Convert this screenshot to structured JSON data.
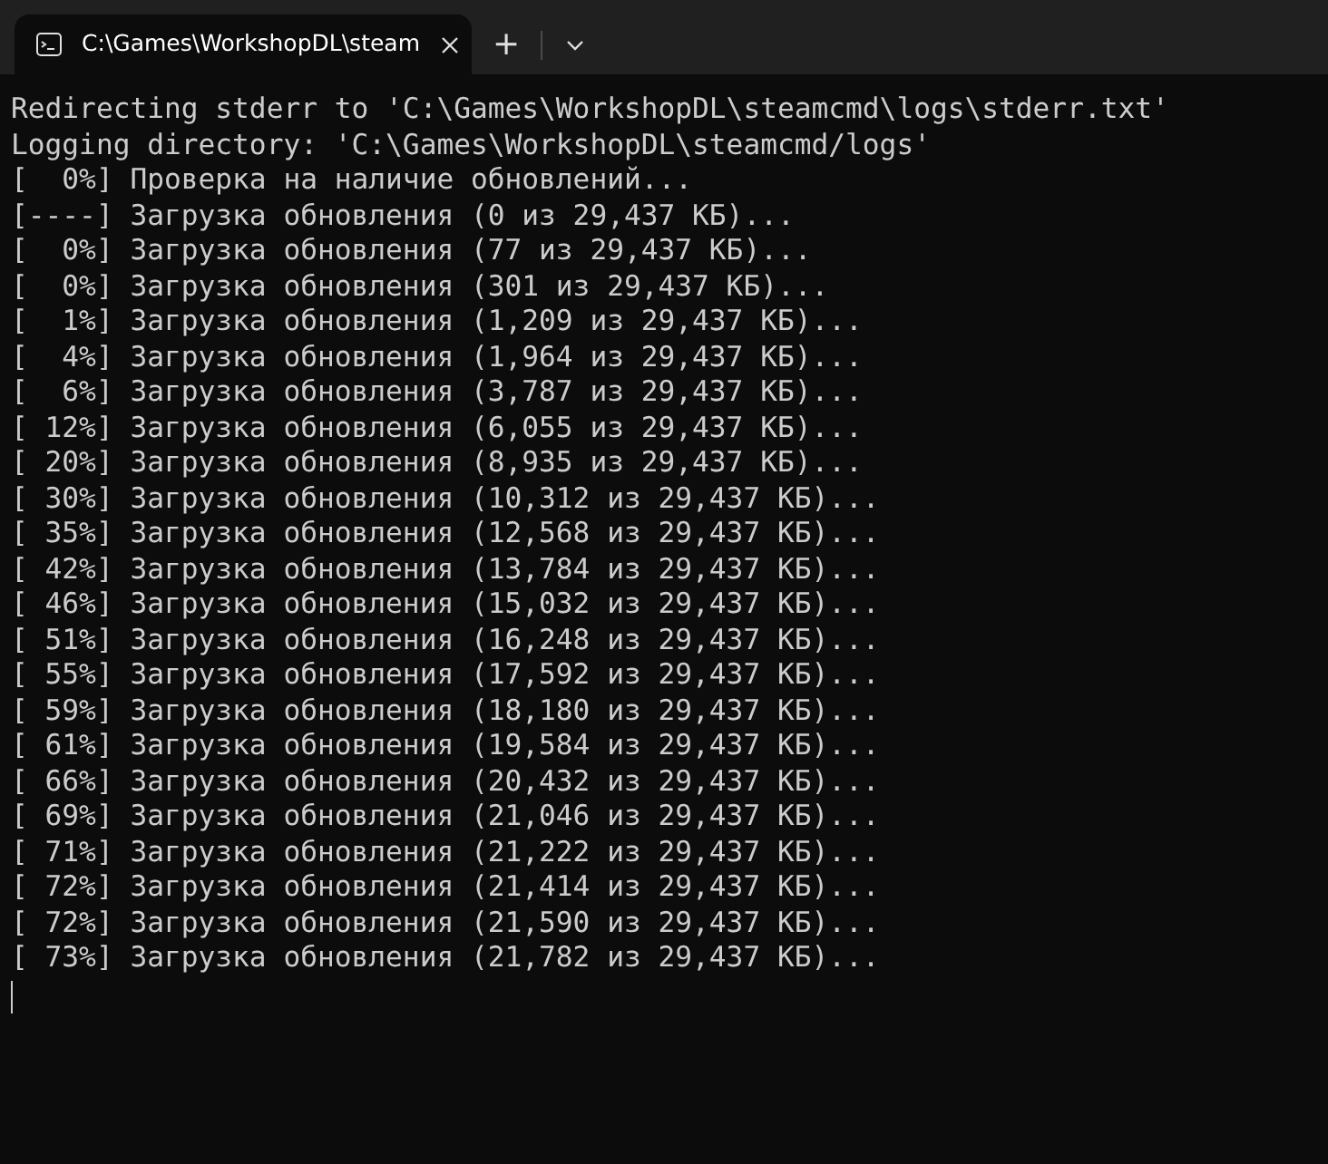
{
  "tab": {
    "title": "C:\\Games\\WorkshopDL\\steam",
    "selected": true
  },
  "new_tab_button": "+",
  "lines": [
    "Redirecting stderr to 'C:\\Games\\WorkshopDL\\steamcmd\\logs\\stderr.txt'",
    "Logging directory: 'C:\\Games\\WorkshopDL\\steamcmd/logs'",
    "[  0%] Проверка на наличие обновлений...",
    "[----] Загрузка обновления (0 из 29,437 КБ)...",
    "[  0%] Загрузка обновления (77 из 29,437 КБ)...",
    "[  0%] Загрузка обновления (301 из 29,437 КБ)...",
    "[  1%] Загрузка обновления (1,209 из 29,437 КБ)...",
    "[  4%] Загрузка обновления (1,964 из 29,437 КБ)...",
    "[  6%] Загрузка обновления (3,787 из 29,437 КБ)...",
    "[ 12%] Загрузка обновления (6,055 из 29,437 КБ)...",
    "[ 20%] Загрузка обновления (8,935 из 29,437 КБ)...",
    "[ 30%] Загрузка обновления (10,312 из 29,437 КБ)...",
    "[ 35%] Загрузка обновления (12,568 из 29,437 КБ)...",
    "[ 42%] Загрузка обновления (13,784 из 29,437 КБ)...",
    "[ 46%] Загрузка обновления (15,032 из 29,437 КБ)...",
    "[ 51%] Загрузка обновления (16,248 из 29,437 КБ)...",
    "[ 55%] Загрузка обновления (17,592 из 29,437 КБ)...",
    "[ 59%] Загрузка обновления (18,180 из 29,437 КБ)...",
    "[ 61%] Загрузка обновления (19,584 из 29,437 КБ)...",
    "[ 66%] Загрузка обновления (20,432 из 29,437 КБ)...",
    "[ 69%] Загрузка обновления (21,046 из 29,437 КБ)...",
    "[ 71%] Загрузка обновления (21,222 из 29,437 КБ)...",
    "[ 72%] Загрузка обновления (21,414 из 29,437 КБ)...",
    "[ 72%] Загрузка обновления (21,590 из 29,437 КБ)...",
    "[ 73%] Загрузка обновления (21,782 из 29,437 КБ)..."
  ]
}
